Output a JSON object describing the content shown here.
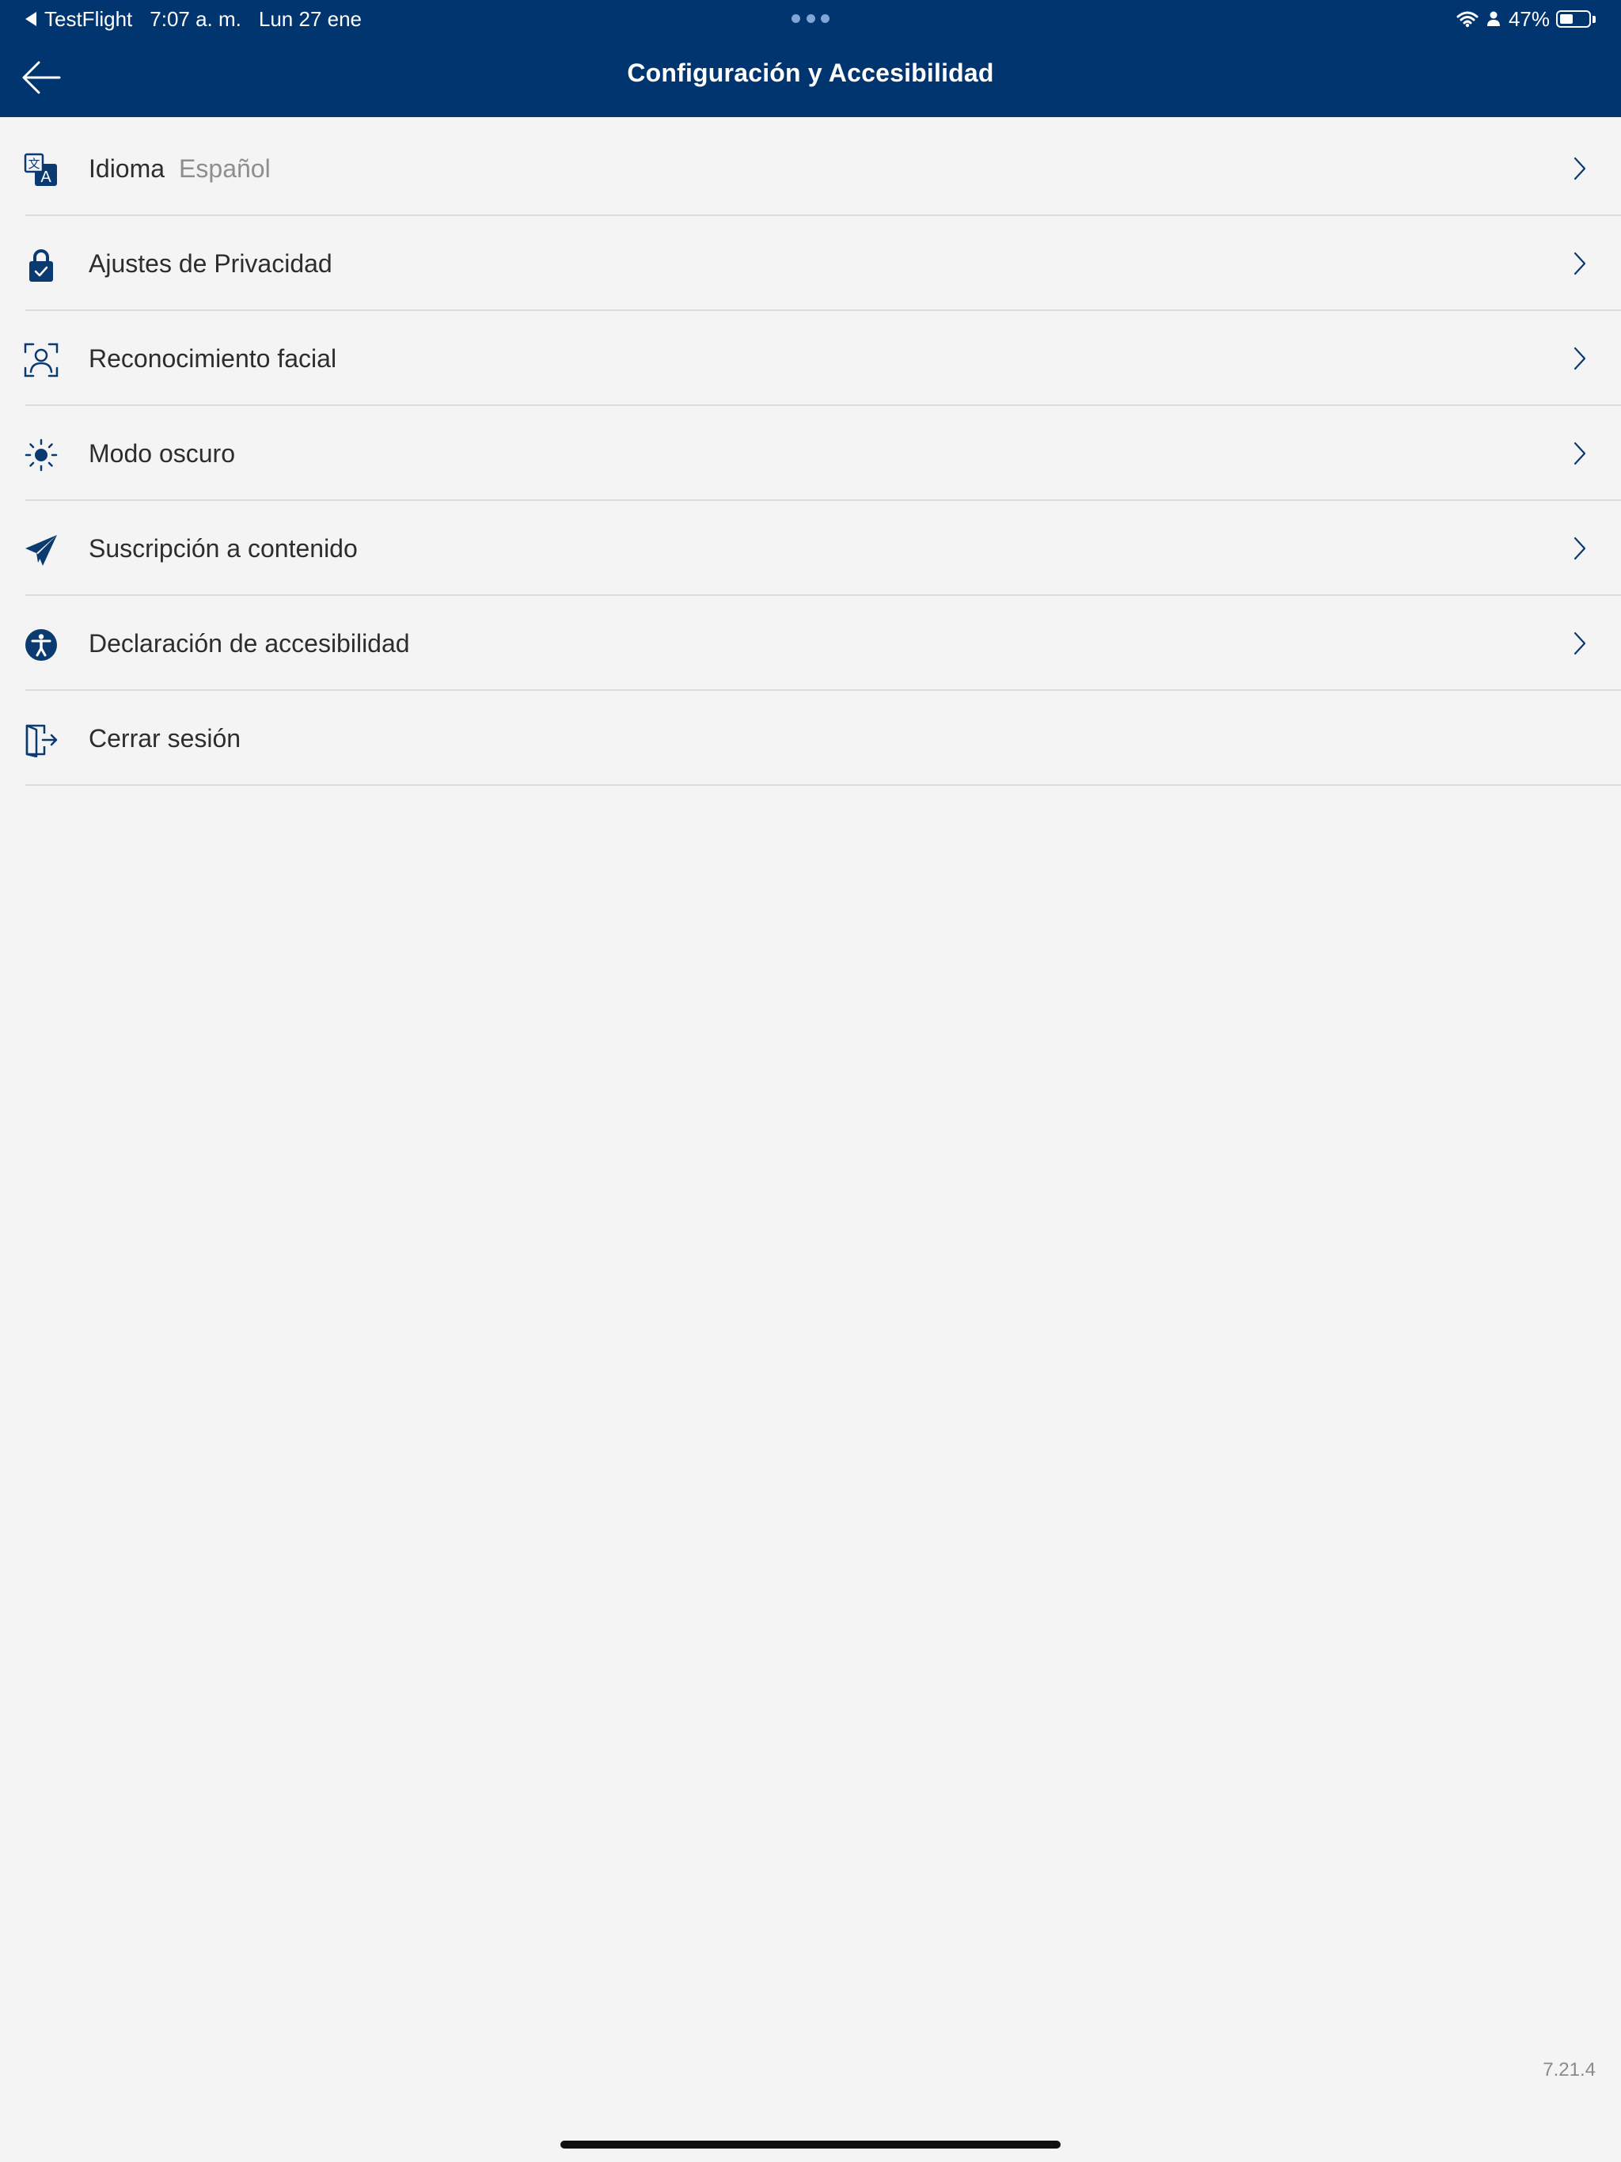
{
  "status_bar": {
    "back_app": "TestFlight",
    "time": "7:07 a. m.",
    "date": "Lun 27 ene",
    "battery_text": "47%",
    "battery_level": 0.47
  },
  "header": {
    "title": "Configuración y Accesibilidad",
    "back_icon": "arrow-left-icon"
  },
  "settings": {
    "items": [
      {
        "label": "Idioma",
        "value": "Español",
        "icon": "translate-icon",
        "chevron": true
      },
      {
        "label": "Ajustes de Privacidad",
        "icon": "lock-icon",
        "chevron": true
      },
      {
        "label": "Reconocimiento facial",
        "icon": "face-scan-icon",
        "chevron": true
      },
      {
        "label": "Modo oscuro",
        "icon": "sun-icon",
        "chevron": true
      },
      {
        "label": "Suscripción a contenido",
        "icon": "paper-plane-icon",
        "chevron": true
      },
      {
        "label": "Declaración de accesibilidad",
        "icon": "accessibility-icon",
        "chevron": true
      },
      {
        "label": "Cerrar sesión",
        "icon": "logout-icon",
        "chevron": false
      }
    ]
  },
  "footer": {
    "version": "7.21.4"
  },
  "colors": {
    "header_bg": "#003570",
    "page_bg": "#f4f4f4",
    "icon": "#0b3a70",
    "separator": "#dcdcdc",
    "secondary_text": "#8e8e8e"
  }
}
